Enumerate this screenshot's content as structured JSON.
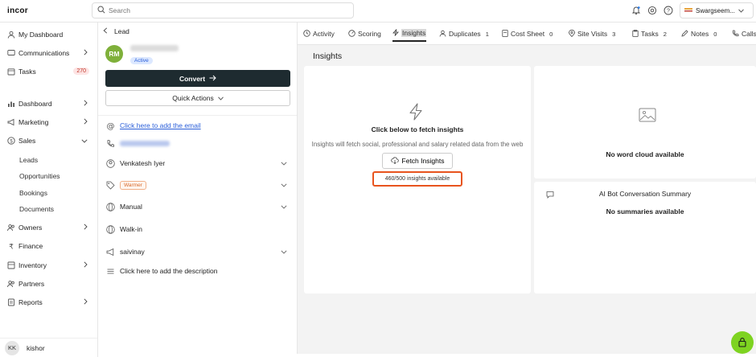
{
  "app": {
    "logo": "incor"
  },
  "search": {
    "placeholder": "Search"
  },
  "org": {
    "name": "Swargseem..."
  },
  "sidebar": {
    "items": [
      {
        "label": "My Dashboard"
      },
      {
        "label": "Communications"
      },
      {
        "label": "Tasks",
        "badge": "270"
      },
      {
        "label": "Dashboard"
      },
      {
        "label": "Marketing"
      },
      {
        "label": "Sales"
      },
      {
        "label": "Owners"
      },
      {
        "label": "Finance"
      },
      {
        "label": "Inventory"
      },
      {
        "label": "Partners"
      },
      {
        "label": "Reports"
      }
    ],
    "sales_sub": [
      "Leads",
      "Opportunities",
      "Bookings",
      "Documents"
    ],
    "user": {
      "initials": "KK",
      "name": "kishor"
    }
  },
  "lead": {
    "back_label": "Lead",
    "initials": "RM",
    "status": "Active",
    "convert_label": "Convert",
    "quick_actions_label": "Quick Actions",
    "email_link": "Click here to add the email",
    "owner": "Venkatesh Iyer",
    "temperature": "Warmer",
    "source": "Manual",
    "channel": "Walk-in",
    "campaign": "saivinay",
    "description_link": "Click here to add the description"
  },
  "tabs": [
    {
      "label": "Activity"
    },
    {
      "label": "Scoring"
    },
    {
      "label": "Insights"
    },
    {
      "label": "Duplicates",
      "count": "1"
    },
    {
      "label": "Cost Sheet",
      "count": "0"
    },
    {
      "label": "Site Visits",
      "count": "3"
    },
    {
      "label": "Tasks",
      "count": "2"
    },
    {
      "label": "Notes",
      "count": "0"
    },
    {
      "label": "Calls"
    }
  ],
  "insights": {
    "title": "Insights",
    "fetch_heading": "Click below to fetch insights",
    "fetch_description": "Insights will fetch social, professional and salary related data from the web",
    "fetch_button": "Fetch Insights",
    "availability": "460/500 insights available"
  },
  "word_cloud": {
    "empty_text": "No word cloud available"
  },
  "ai_bot": {
    "title": "AI Bot Conversation Summary",
    "empty_text": "No summaries available"
  }
}
